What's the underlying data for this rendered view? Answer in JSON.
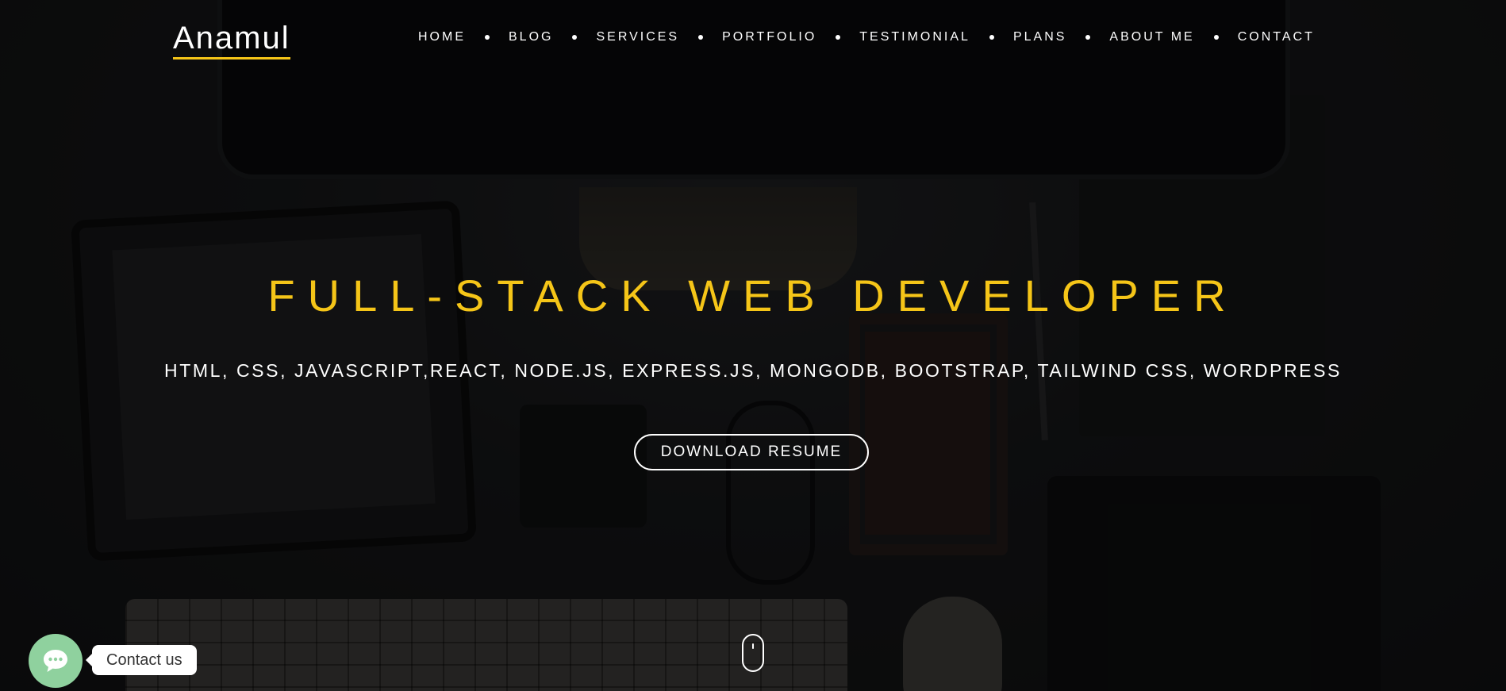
{
  "header": {
    "logo": "Anamul",
    "nav": [
      {
        "label": "HOME"
      },
      {
        "label": "BLOG"
      },
      {
        "label": "SERVICES"
      },
      {
        "label": "PORTFOLIO"
      },
      {
        "label": "TESTIMONIAL"
      },
      {
        "label": "PLANS"
      },
      {
        "label": "ABOUT ME"
      },
      {
        "label": "CONTACT"
      }
    ]
  },
  "hero": {
    "title": "FULL-STACK WEB DEVELOPER",
    "skills": "HTML, CSS, JAVASCRIPT,REACT, NODE.JS, EXPRESS.JS, MONGODB, BOOTSTRAP, TAILWIND CSS, WORDPRESS",
    "download_label": "DOWNLOAD RESUME",
    "scroll_icon": "mouse-scroll-icon"
  },
  "chat_widget": {
    "icon": "chat-bubble-icon",
    "label": "Contact us"
  },
  "colors": {
    "accent": "#f5c518",
    "chat": "#8fd19e",
    "text": "#ffffff"
  }
}
